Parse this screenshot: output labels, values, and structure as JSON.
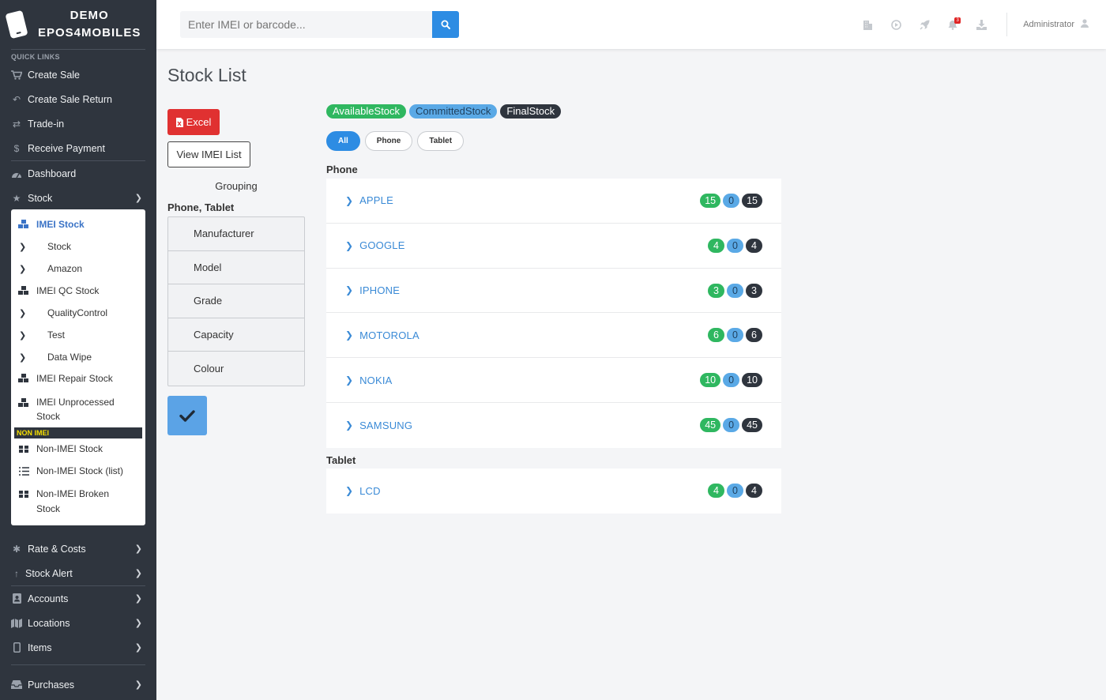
{
  "brand": {
    "line1": "DEMO",
    "line2": "EPOS4MOBILES"
  },
  "sidebar": {
    "quick_links_title": "QUICK LINKS",
    "quick_links": [
      {
        "label": "Create Sale",
        "icon": "cart-icon"
      },
      {
        "label": "Create Sale Return",
        "icon": "undo-icon"
      },
      {
        "label": "Trade-in",
        "icon": "exchange-icon"
      },
      {
        "label": "Receive Payment",
        "icon": "dollar-icon"
      }
    ],
    "dashboard": "Dashboard",
    "stock": "Stock",
    "submenu": {
      "imei_stock": "IMEI Stock",
      "stock": "Stock",
      "amazon": "Amazon",
      "imei_qc_stock": "IMEI QC Stock",
      "quality_control": "QualityControl",
      "test": "Test",
      "data_wipe": "Data Wipe",
      "imei_repair_stock": "IMEI Repair Stock",
      "imei_unprocessed_line1": "IMEI Unprocessed",
      "imei_unprocessed_line2": "Stock",
      "non_imei_header": "NON IMEI",
      "non_imei_stock": "Non-IMEI Stock",
      "non_imei_stock_list": "Non-IMEI Stock (list)",
      "non_imei_broken_line1": "Non-IMEI Broken",
      "non_imei_broken_line2": "Stock"
    },
    "rate_costs": "Rate & Costs",
    "stock_alert": "Stock Alert",
    "accounts": "Accounts",
    "locations": "Locations",
    "items": "Items",
    "purchases": "Purchases"
  },
  "topbar": {
    "search_placeholder": "Enter IMEI or barcode...",
    "notification_count": "3",
    "user": "Administrator"
  },
  "page": {
    "title": "Stock List",
    "excel_label": "Excel",
    "view_imei_label": "View IMEI List",
    "grouping_title": "Grouping",
    "groups_label": "Phone, Tablet",
    "group_options": [
      "Manufacturer",
      "Model",
      "Grade",
      "Capacity",
      "Colour"
    ]
  },
  "legend": {
    "available": "AvailableStock",
    "committed": "CommittedStock",
    "final": "FinalStock"
  },
  "filters": {
    "all": "All",
    "phone": "Phone",
    "tablet": "Tablet"
  },
  "sections": [
    {
      "label": "Phone",
      "rows": [
        {
          "name": "APPLE",
          "available": "15",
          "committed": "0",
          "final": "15"
        },
        {
          "name": "GOOGLE",
          "available": "4",
          "committed": "0",
          "final": "4"
        },
        {
          "name": "IPHONE",
          "available": "3",
          "committed": "0",
          "final": "3"
        },
        {
          "name": "MOTOROLA",
          "available": "6",
          "committed": "0",
          "final": "6"
        },
        {
          "name": "NOKIA",
          "available": "10",
          "committed": "0",
          "final": "10"
        },
        {
          "name": "SAMSUNG",
          "available": "45",
          "committed": "0",
          "final": "45"
        }
      ]
    },
    {
      "label": "Tablet",
      "rows": [
        {
          "name": "LCD",
          "available": "4",
          "committed": "0",
          "final": "4"
        }
      ]
    }
  ],
  "colors": {
    "sidebar": "#2f353e",
    "primary": "#2d8ce3",
    "available": "#2fb760",
    "committed": "#5aa9e6",
    "final": "#2f353e",
    "excel": "#e03131"
  }
}
